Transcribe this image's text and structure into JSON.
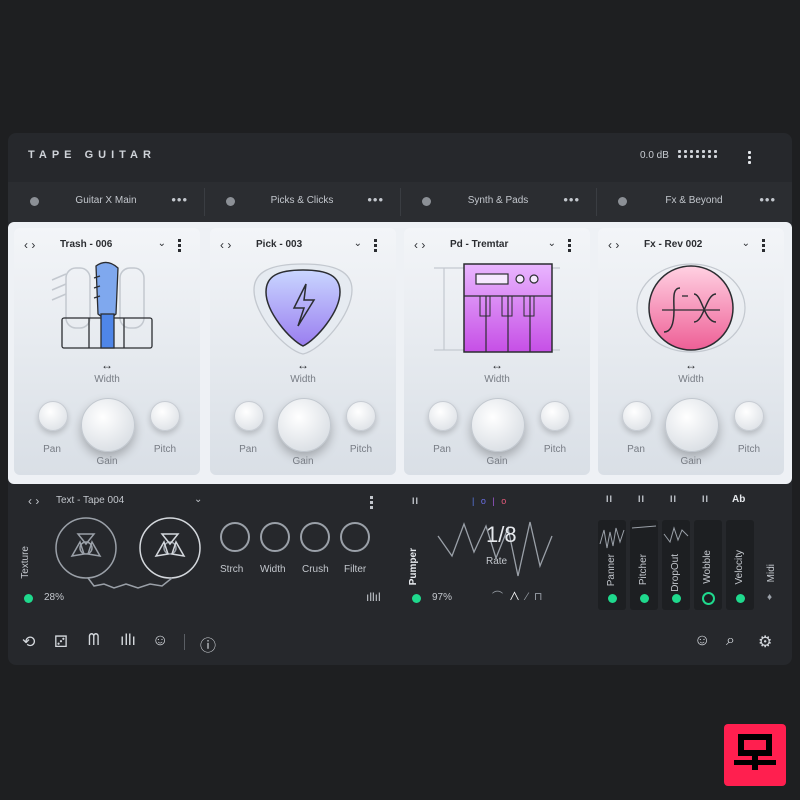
{
  "header": {
    "title": "TAPE GUITAR",
    "output_level": "0.0 dB"
  },
  "tabs": [
    {
      "label": "Guitar X Main",
      "more": "•••"
    },
    {
      "label": "Picks & Clicks",
      "more": "•••"
    },
    {
      "label": "Synth & Pads",
      "more": "•••"
    },
    {
      "label": "Fx & Beyond",
      "more": "•••"
    }
  ],
  "slots": [
    {
      "name": "Trash - 006",
      "width_label": "Width",
      "pan_label": "Pan",
      "gain_label": "Gain",
      "pitch_label": "Pitch",
      "art": "guitar-icon"
    },
    {
      "name": "Pick - 003",
      "width_label": "Width",
      "pan_label": "Pan",
      "gain_label": "Gain",
      "pitch_label": "Pitch",
      "art": "guitar-pick-icon"
    },
    {
      "name": "Pd - Tremtar",
      "width_label": "Width",
      "pan_label": "Pan",
      "gain_label": "Gain",
      "pitch_label": "Pitch",
      "art": "keyboard-synth-icon"
    },
    {
      "name": "Fx - Rev 002",
      "width_label": "Width",
      "pan_label": "Pan",
      "gain_label": "Gain",
      "pitch_label": "Pitch",
      "art": "fx-logo-icon"
    }
  ],
  "texture": {
    "preset": "Text - Tape 004",
    "label": "Texture",
    "amount": "28%",
    "knobs": [
      "Strch",
      "Width",
      "Crush",
      "Filter"
    ]
  },
  "pumper": {
    "label": "Pumper",
    "amount": "97%",
    "rate_value": "1/8",
    "rate_label": "Rate"
  },
  "modulators": [
    {
      "label": "Panner"
    },
    {
      "label": "Pitcher"
    },
    {
      "label": "DropOut"
    },
    {
      "label": "Wobble"
    },
    {
      "label": "Velocity",
      "header": "Ab"
    },
    {
      "label": "Midi"
    }
  ],
  "colors": {
    "accent_green": "#1fd98d",
    "guitar_blue": "#7fa8ee",
    "pick_purple": "#a38cf0",
    "synth_magenta": "#dd5df0",
    "fx_pink": "#f06fa0",
    "logo_red": "#ff1f4f"
  }
}
